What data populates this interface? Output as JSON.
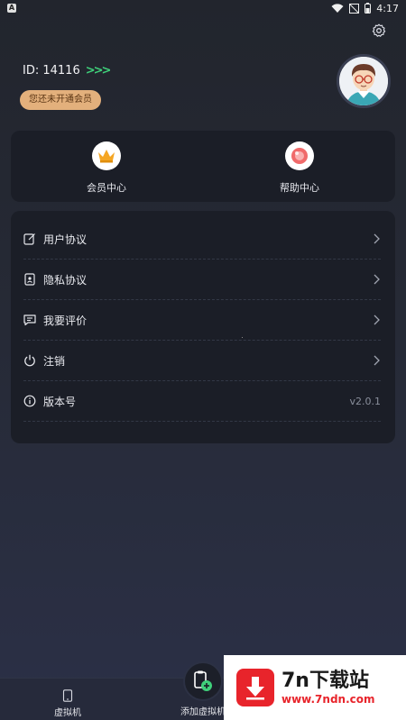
{
  "status_bar": {
    "time": "4:17",
    "left_icon": "A"
  },
  "profile": {
    "id_label": "ID: 14116",
    "arrows": ">>>",
    "vip_badge": "您还未开通会员"
  },
  "quick_actions": [
    {
      "label": "会员中心",
      "icon": "crown-icon"
    },
    {
      "label": "帮助中心",
      "icon": "help-bubble-icon"
    }
  ],
  "menu": {
    "items": [
      {
        "label": "用户协议",
        "icon": "edit-document-icon"
      },
      {
        "label": "隐私协议",
        "icon": "id-card-icon"
      },
      {
        "label": "我要评价",
        "icon": "chat-icon"
      },
      {
        "label": "注销",
        "icon": "power-icon"
      },
      {
        "label": "版本号",
        "icon": "info-icon",
        "value": "v2.0.1"
      }
    ]
  },
  "tabbar": {
    "vm_label": "虚拟机",
    "add_label": "添加虚拟机"
  },
  "ad": {
    "title": "7n下载站",
    "url": "www.7ndn.com"
  },
  "colors": {
    "accent_arrows": "#3fd07a",
    "vip_badge_bg": "#e3b07c",
    "ad_red": "#e8242b"
  }
}
